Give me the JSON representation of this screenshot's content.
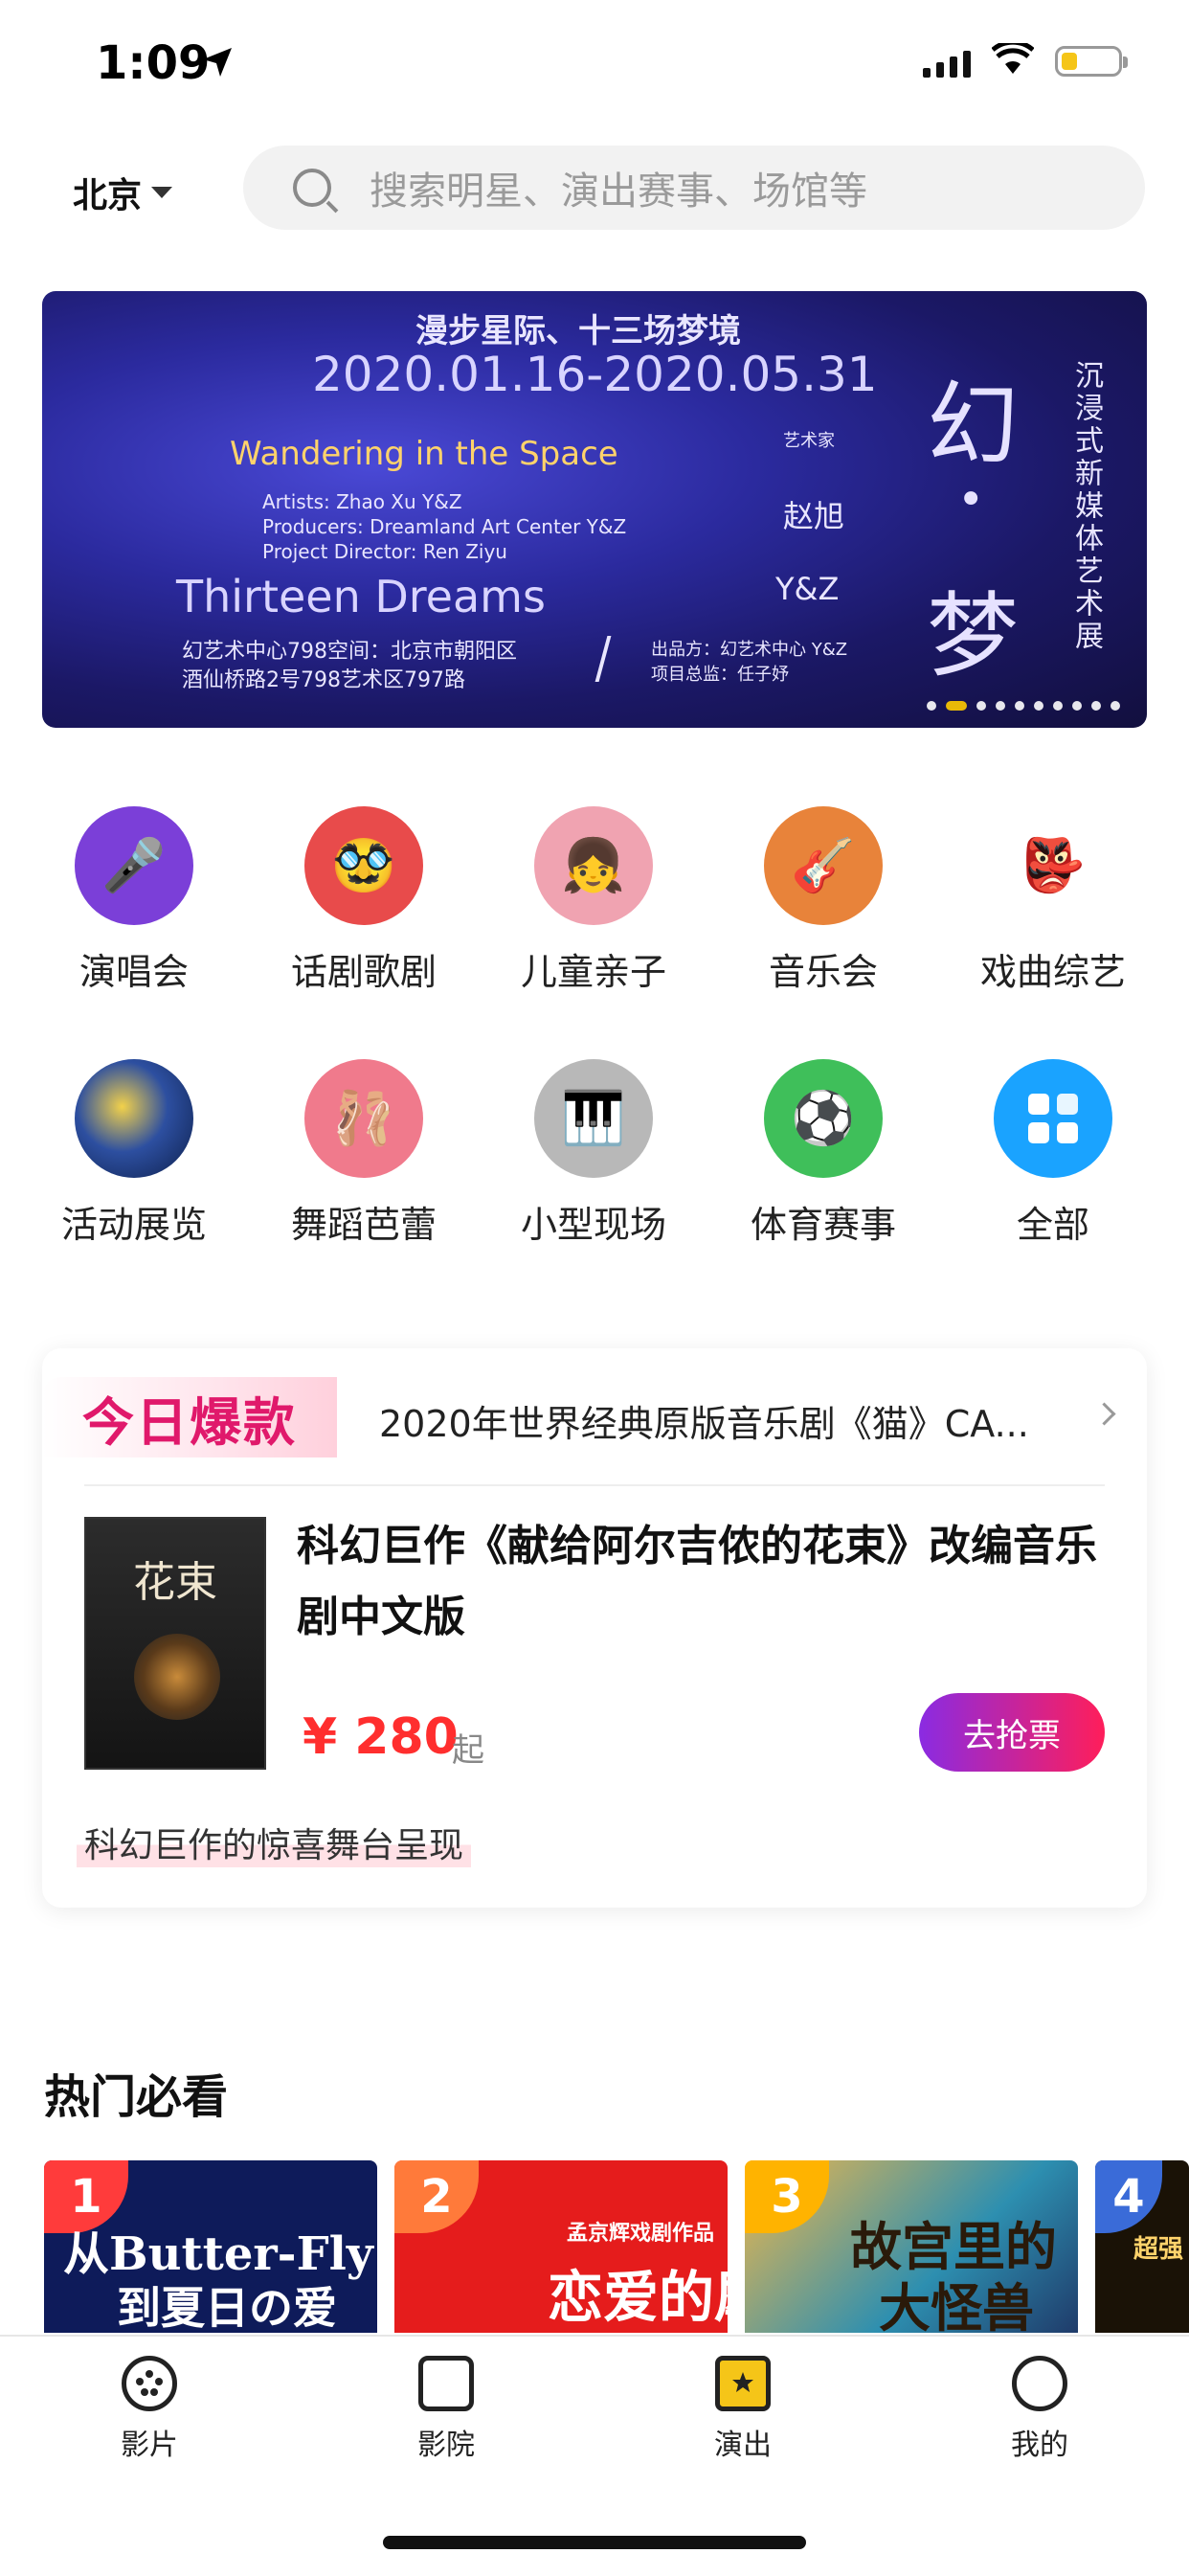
{
  "status_bar": {
    "time": "1:09"
  },
  "header": {
    "city": "北京",
    "search_placeholder": "搜索明星、演出赛事、场馆等"
  },
  "banner": {
    "line1": "漫步星际、十三场梦境",
    "dates": "2020.01.16-2020.05.31",
    "en_title": "Wandering in the Space",
    "artists": "Artists: Zhao Xu  Y&Z",
    "producers": "Producers: Dreamland Art Center  Y&Z",
    "director": "Project Director: Ren Ziyu",
    "en_title2": "Thirteen Dreams",
    "venue1": "幻艺术中心798空间：北京市朝阳区",
    "venue2": "酒仙桥路2号798艺术区797路",
    "artist_label": "艺术家",
    "artist1": "赵旭",
    "artist2": "Y&Z",
    "producer_cn": "出品方：幻艺术中心  Y&Z",
    "director_cn": "项目总监：任子妤",
    "big1": "幻",
    "dot": "•",
    "big2": "梦",
    "vertical": "沉浸式新媒体艺术展"
  },
  "categories": [
    {
      "label": "演唱会",
      "icon": "microphone-icon",
      "color": "#7b3fd8"
    },
    {
      "label": "话剧歌剧",
      "icon": "mask-glasses-icon",
      "color": "#e84b4b"
    },
    {
      "label": "儿童亲子",
      "icon": "girl-face-icon",
      "color": "#f0a3b1"
    },
    {
      "label": "音乐会",
      "icon": "guitar-icon",
      "color": "#e8833a"
    },
    {
      "label": "戏曲综艺",
      "icon": "opera-mask-icon",
      "color": "#ffffff"
    },
    {
      "label": "活动展览",
      "icon": "starry-night-icon",
      "color": "#2d4fa0"
    },
    {
      "label": "舞蹈芭蕾",
      "icon": "ballet-icon",
      "color": "#f07a8c"
    },
    {
      "label": "小型现场",
      "icon": "piano-icon",
      "color": "#b8b8b8"
    },
    {
      "label": "体育赛事",
      "icon": "football-icon",
      "color": "#3fbf5a"
    },
    {
      "label": "全部",
      "icon": "grid-icon",
      "color": "#1aa3ff"
    }
  ],
  "hot_today": {
    "tag": "今日爆款",
    "headline": "2020年世界经典原版音乐剧《猫》CA...",
    "product_title": "科幻巨作《献给阿尔吉侬的花束》改编音乐剧中文版",
    "price": "¥ 280",
    "price_suffix": "起",
    "buy_label": "去抢票",
    "description": "科幻巨作的惊喜舞台呈现"
  },
  "popular": {
    "title": "热门必看",
    "items": [
      {
        "rank": "1",
        "line1": "从Butter-Fly",
        "line2": "到夏日の爱"
      },
      {
        "rank": "2",
        "line1": "孟京辉戏剧作品",
        "line2": "恋爱的犀牛"
      },
      {
        "rank": "3",
        "line1": "故宫里的",
        "line2": "大怪兽"
      },
      {
        "rank": "4",
        "line1": "超强",
        "line2": ""
      }
    ]
  },
  "tabbar": [
    {
      "label": "影片",
      "icon": "film-reel-icon"
    },
    {
      "label": "影院",
      "icon": "cinema-icon"
    },
    {
      "label": "演出",
      "icon": "ticket-icon",
      "active": true
    },
    {
      "label": "我的",
      "icon": "user-icon"
    }
  ],
  "colors": {
    "accent": "#ff2e2e",
    "brand_gradient_start": "#8a2be2",
    "brand_gradient_end": "#ff1e5a",
    "active_tab": "#f5c518"
  }
}
